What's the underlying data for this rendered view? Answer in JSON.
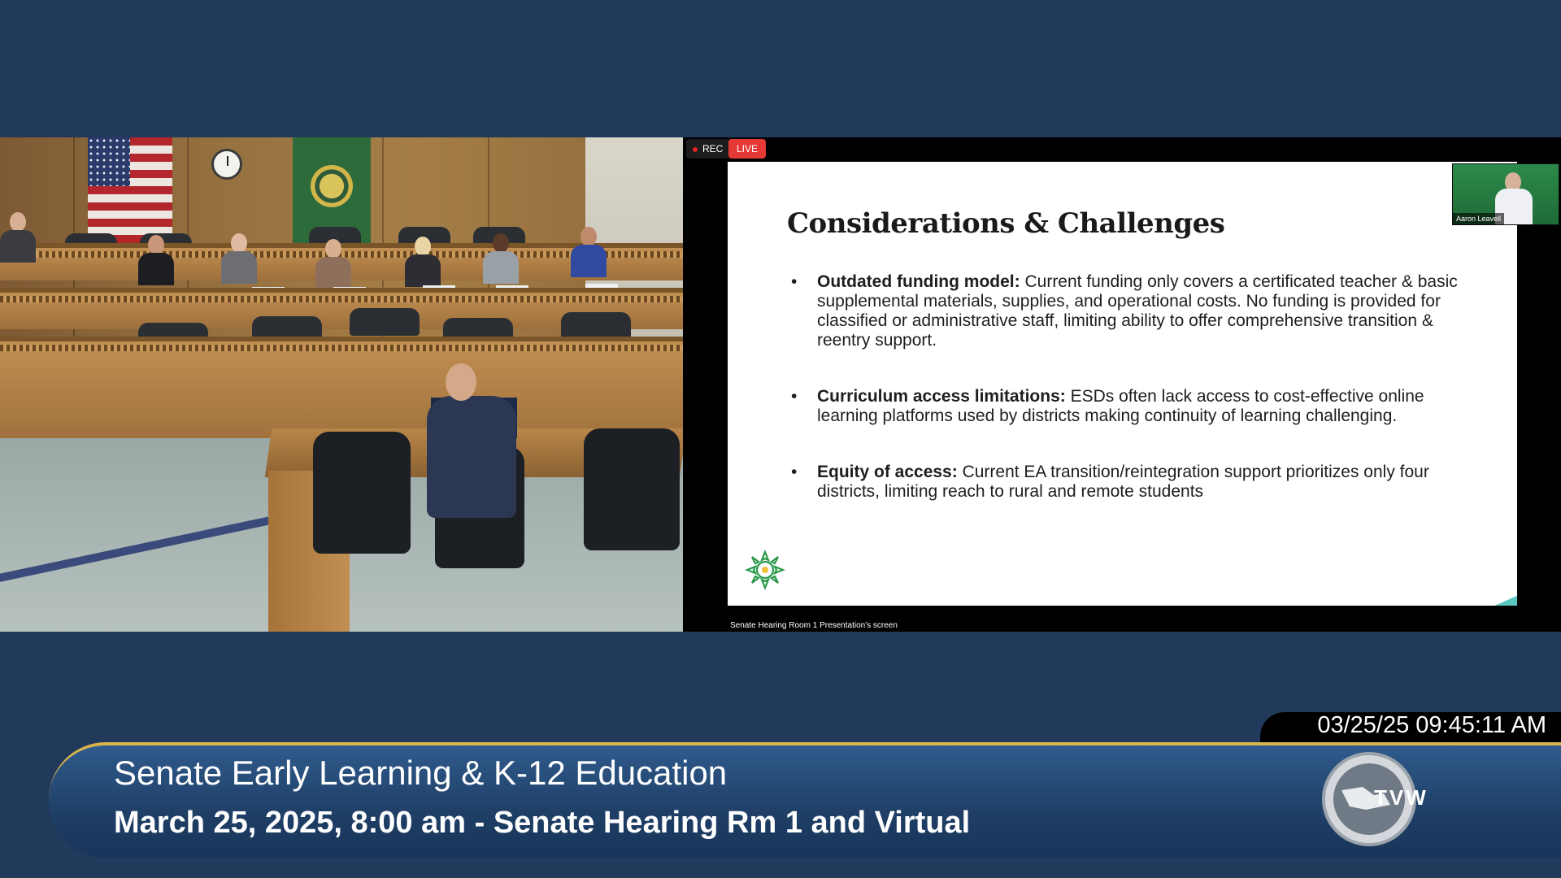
{
  "recording": {
    "rec_label": "REC",
    "live_label": "LIVE"
  },
  "slide": {
    "title": "Considerations & Challenges",
    "bullets": [
      {
        "heading": "Outdated funding model:",
        "text": " Current funding only covers a certificated teacher & basic supplemental materials, supplies, and operational costs. No funding is provided for classified or administrative staff, limiting ability to offer comprehensive transition & reentry support."
      },
      {
        "heading": "Curriculum access limitations:",
        "text": " ESDs often lack access to cost-effective online learning  platforms used by districts making continuity of learning challenging."
      },
      {
        "heading": "Equity of access:",
        "text": " Current EA transition/reintegration support prioritizes only four districts, limiting reach to rural and remote students"
      }
    ],
    "accent_colors": [
      "#1e8a3c",
      "#7ac943",
      "#5cc7c0"
    ]
  },
  "webcam": {
    "participant_name": "Aaron Leavell"
  },
  "screen_caption": "Senate Hearing Room 1 Presentation's screen",
  "timestamp": "03/25/25 09:45:11 AM",
  "lower_third": {
    "committee": "Senate Early Learning & K-12 Education",
    "session": "March 25, 2025, 8:00 am - Senate Hearing Rm 1 and Virtual",
    "accent": "#d9b54a"
  },
  "tvw_logo": {
    "label": "TVW"
  }
}
